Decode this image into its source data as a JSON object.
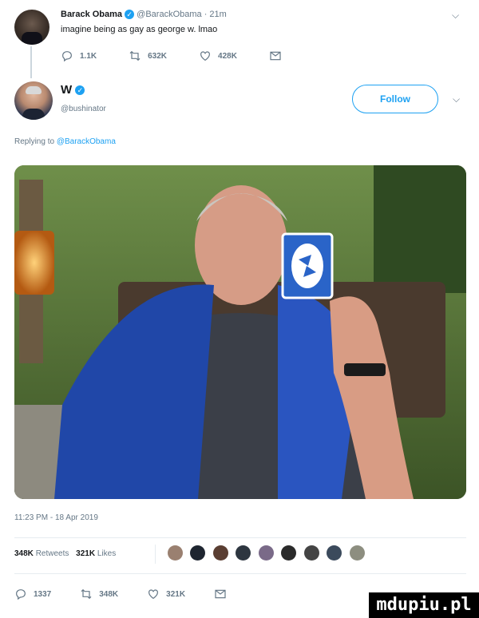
{
  "reply_tweet": {
    "name": "Barack Obama",
    "handle_time": "@BarackObama · 21m",
    "text": "imagine being as gay as george w. lmao",
    "actions": {
      "replies": "1.1K",
      "retweets": "632K",
      "likes": "428K"
    }
  },
  "main_tweet": {
    "name": "W",
    "handle": "@bushinator",
    "follow_label": "Follow",
    "replying_prefix": "Replying to ",
    "replying_to": "@BarackObama",
    "timestamp": "11:23 PM - 18 Apr 2019",
    "retweets_count": "348K",
    "retweets_label": "Retweets",
    "likes_count": "321K",
    "likes_label": "Likes",
    "actions": {
      "replies": "1337",
      "retweets": "348K",
      "likes": "321K"
    }
  },
  "watermark": "mdupiu.pl",
  "colors": {
    "accent": "#1da1f2",
    "muted": "#657786",
    "divider": "#e6ecf0"
  }
}
